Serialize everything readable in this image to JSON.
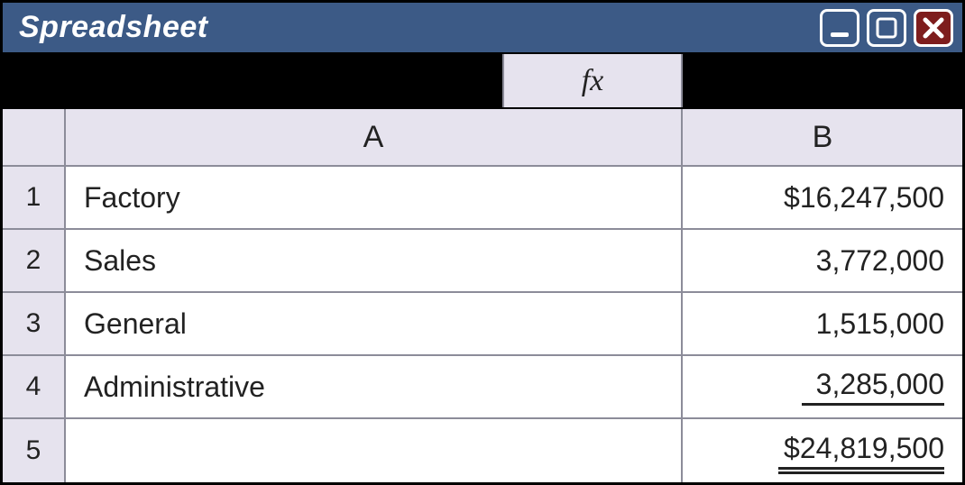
{
  "window": {
    "title": "Spreadsheet"
  },
  "formulaBar": {
    "fxLabel": "fx"
  },
  "columns": [
    "A",
    "B"
  ],
  "rows": [
    {
      "num": "1",
      "a": "Factory",
      "b": "$16,247,500",
      "b_style": ""
    },
    {
      "num": "2",
      "a": "Sales",
      "b": "3,772,000",
      "b_style": ""
    },
    {
      "num": "3",
      "a": "General",
      "b": "1,515,000",
      "b_style": ""
    },
    {
      "num": "4",
      "a": "Administrative",
      "b": "3,285,000",
      "b_style": "single"
    },
    {
      "num": "5",
      "a": "",
      "b": "$24,819,500",
      "b_style": "double"
    }
  ]
}
